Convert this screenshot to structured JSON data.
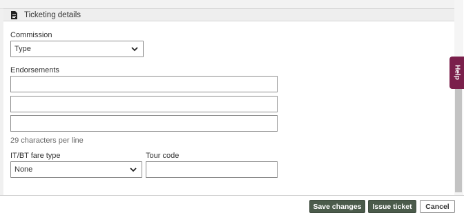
{
  "section": {
    "title": "Ticketing details",
    "icon": "document-icon"
  },
  "commission": {
    "label": "Commission",
    "selected": "Type"
  },
  "endorsements": {
    "label": "Endorsements",
    "lines": [
      "",
      "",
      ""
    ],
    "hint": "29 characters per line"
  },
  "fare_type": {
    "label": "IT/BT fare type",
    "selected": "None"
  },
  "tour_code": {
    "label": "Tour code",
    "value": ""
  },
  "help": {
    "label": "Help"
  },
  "footer": {
    "save_label": "Save changes",
    "issue_label": "Issue ticket",
    "cancel_label": "Cancel"
  },
  "colors": {
    "primary_button": "#4b5b4b",
    "help_tab": "#7a1f4b"
  }
}
